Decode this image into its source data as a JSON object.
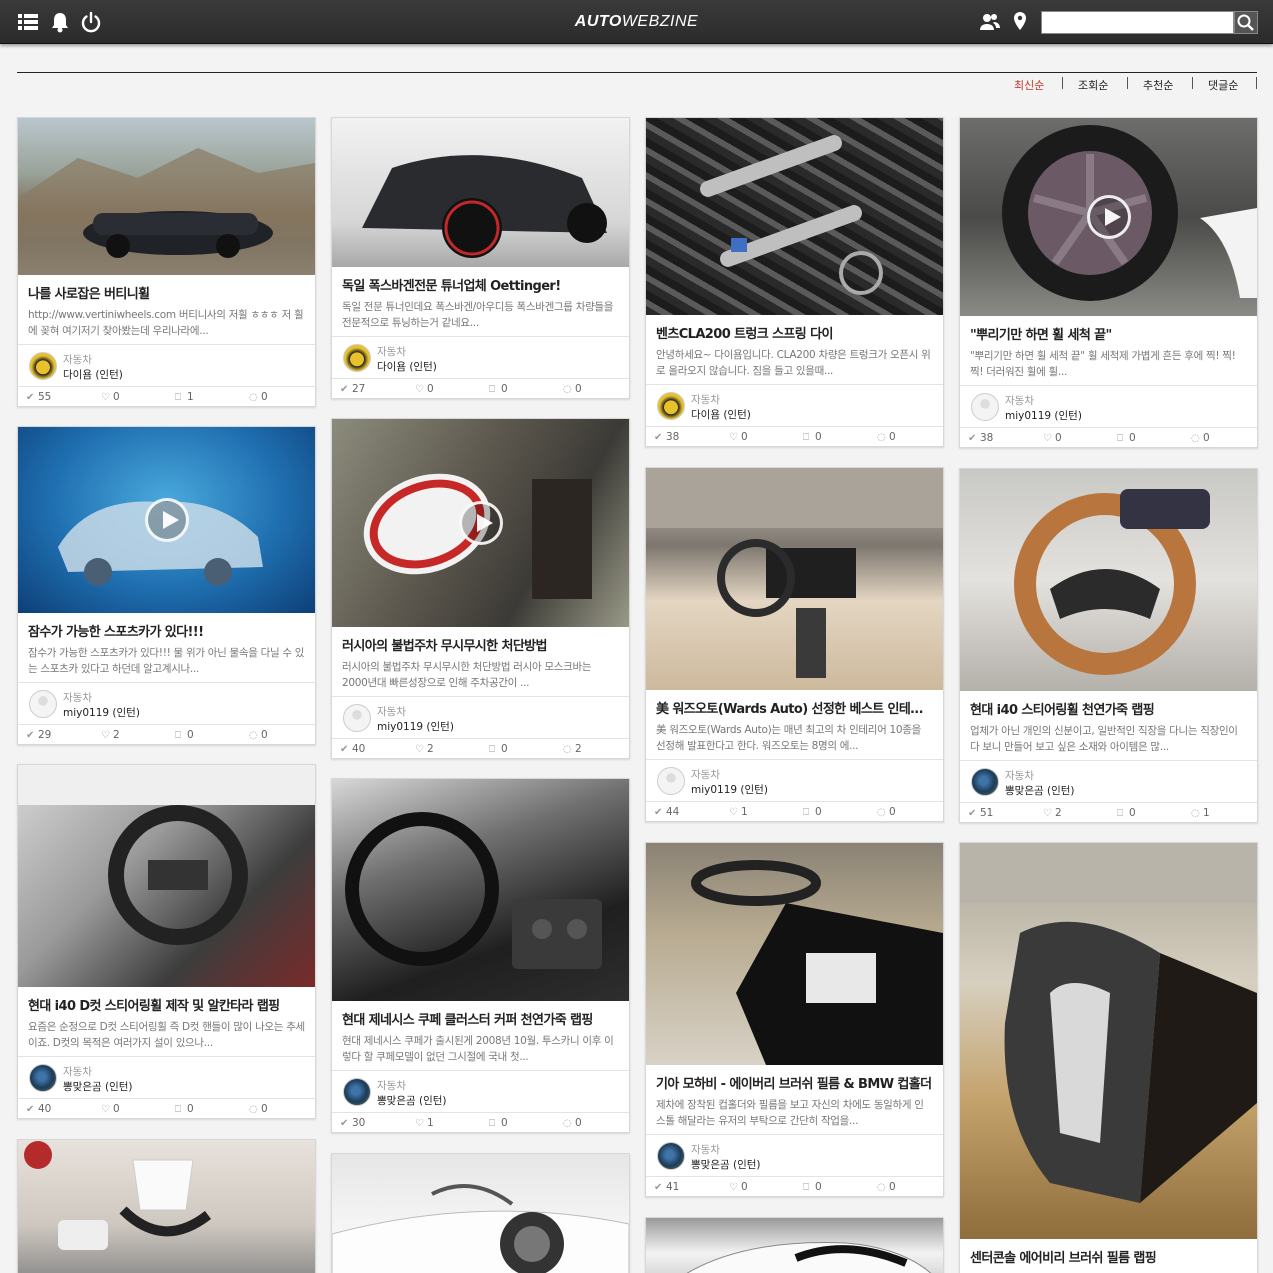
{
  "header": {
    "logo_bold": "AUTO",
    "logo_light": "WEBZINE",
    "menu_icon": "list-icon",
    "bell_icon": "bell-icon",
    "power_icon": "power-icon",
    "users_icon": "users-icon",
    "location_icon": "map-pin-icon",
    "search_icon": "search-icon",
    "search_value": ""
  },
  "sort": {
    "items": [
      "최신순",
      "조회순",
      "추천순",
      "댓글순"
    ],
    "active": "최신순",
    "active_color": "#c0392b"
  },
  "cards": [
    {
      "title": "나를 사로잡은 버티니휠",
      "excerpt": "http://www.vertiniwheels.com 버티니사의 저휠 ㅎㅎㅎ 저 휠에 꽂혀 여기저기 찾아봤는데 우리나라에...",
      "category": "자동차",
      "author": "다이욤 (인턴)",
      "views": "55",
      "likes": "0",
      "bookmarks": "1",
      "comments": "0",
      "video": false
    },
    {
      "title": "독일 폭스바겐전문 튜너업체 Oettinger!",
      "excerpt": "독일 전문 튜너인데요 폭스바겐/아우디등 폭스바겐그룹 차량들을 전문적으로 튜닝하는거 같네요...",
      "category": "자동차",
      "author": "다이욤 (인턴)",
      "views": "27",
      "likes": "0",
      "bookmarks": "0",
      "comments": "0",
      "video": false
    },
    {
      "title": "벤츠CLA200 트렁크 스프링 다이",
      "excerpt": "안녕하세요~ 다이욤입니다. CLA200 차량은 트렁크가 오픈시 위로 올라오지 않습니다. 짐을 들고 있을때...",
      "category": "자동차",
      "author": "다이욤 (인턴)",
      "views": "38",
      "likes": "0",
      "bookmarks": "0",
      "comments": "0",
      "video": false
    },
    {
      "title": "\"뿌리기만 하면 휠 세척 끝\"",
      "excerpt": "\"뿌리기만 하면 휠 세척 끝\" 휠 세척제 가볍게 흔든 후에 찍! 찍!찍! 더러워진 휠에 휠...",
      "category": "자동차",
      "author": "miy0119 (인턴)",
      "views": "38",
      "likes": "0",
      "bookmarks": "0",
      "comments": "0",
      "video": true
    },
    {
      "title": "잠수가 가능한 스포츠카가 있다!!!",
      "excerpt": "잠수가 가능한 스포츠카가 있다!!! 물 위가 아닌 물속을 다닐 수 있는 스포츠카 있다고 하던데 알고계시나...",
      "category": "자동차",
      "author": "miy0119 (인턴)",
      "views": "29",
      "likes": "2",
      "bookmarks": "0",
      "comments": "0",
      "video": true
    },
    {
      "title": "러시아의 불법주차 무시무시한 처단방법",
      "excerpt": "러시아의 불법주차 무시무시한 처단방법 러시아 모스크바는 2000년대 빠른성장으로 인해 주차공간이 ...",
      "category": "자동차",
      "author": "miy0119 (인턴)",
      "views": "40",
      "likes": "2",
      "bookmarks": "0",
      "comments": "2",
      "video": true
    },
    {
      "title": "美 워즈오토(Wards Auto) 선정한 베스트 인테리어 T...",
      "excerpt": "美 워즈오토(Wards Auto)는 매년 최고의 차 인테리어 10종을 선정해 발표한다고 한다. 워즈오토는 8명의 에...",
      "category": "자동차",
      "author": "miy0119 (인턴)",
      "views": "44",
      "likes": "1",
      "bookmarks": "0",
      "comments": "0",
      "video": false
    },
    {
      "title": "현대 i40 스티어링휠 천연가죽 랩핑",
      "excerpt": "업체가 아닌 개인의 신분이고, 일반적인 직장을 다니는 직장인이다 보니 만들어 보고 싶은 소재와 아이템은 많...",
      "category": "자동차",
      "author": "뽕맞은곰 (인턴)",
      "views": "51",
      "likes": "2",
      "bookmarks": "0",
      "comments": "1",
      "video": false
    },
    {
      "title": "현대 i40 D컷 스티어링휠 제작 및 알칸타라 랩핑",
      "excerpt": "요즘은 순정으로 D컷 스티어링휠 즉 D컷 핸들이 많이 나오는 추세이죠. D컷의 목적은 여러가지 설이 있으나...",
      "category": "자동차",
      "author": "뽕맞은곰 (인턴)",
      "views": "40",
      "likes": "0",
      "bookmarks": "0",
      "comments": "0",
      "video": false
    },
    {
      "title": "현대 제네시스 쿠페 클러스터 커퍼 천연가죽 랩핑",
      "excerpt": "현대 제네시스 쿠페가 출시된게 2008년 10월. 투스카니 이후 이렇다 할 쿠페모델이 없던 그시절에 국내 첫...",
      "category": "자동차",
      "author": "뽕맞은곰 (인턴)",
      "views": "30",
      "likes": "1",
      "bookmarks": "0",
      "comments": "0",
      "video": false
    },
    {
      "title": "기아 모하비 - 에이버리 브러쉬 필름 & BMW 컵홀더",
      "excerpt": "제차에 장착된 컵홀더와 필름을 보고 자신의 차에도 동일하게 인스톨 해달라는 유저의 부탁으로 간단히 작업을...",
      "category": "자동차",
      "author": "뽕맞은곰 (인턴)",
      "views": "41",
      "likes": "0",
      "bookmarks": "0",
      "comments": "0",
      "video": false
    },
    {
      "title": "센터콘솔 에어비리 브러쉬 필름 랩핑",
      "excerpt": "",
      "category": "",
      "author": "",
      "views": "",
      "likes": "",
      "bookmarks": "",
      "comments": "",
      "video": false
    },
    {
      "title": "",
      "excerpt": "",
      "category": "",
      "author": "",
      "views": "",
      "likes": "",
      "bookmarks": "",
      "comments": "",
      "video": false
    },
    {
      "title": "",
      "excerpt": "",
      "category": "",
      "author": "",
      "views": "",
      "likes": "",
      "bookmarks": "",
      "comments": "",
      "video": false
    },
    {
      "title": "",
      "excerpt": "",
      "category": "",
      "author": "",
      "views": "",
      "likes": "",
      "bookmarks": "",
      "comments": "",
      "video": false
    }
  ]
}
